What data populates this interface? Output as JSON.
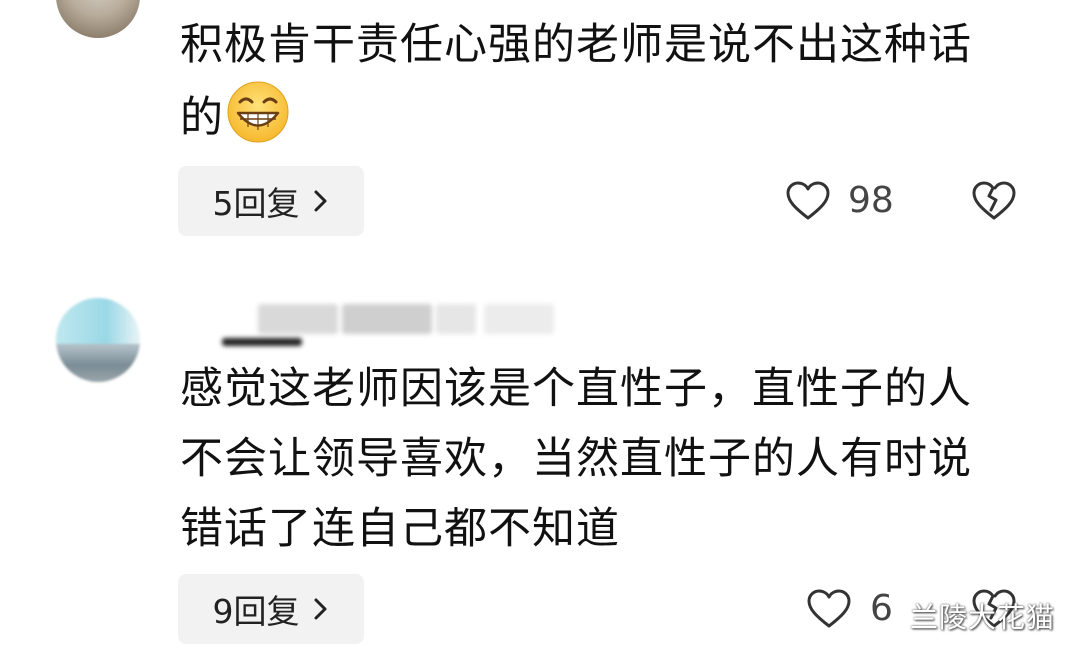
{
  "comments": [
    {
      "text": "积极肯干责任心强的老师是说不出这种话的",
      "emoji": "grinning-face-emoji",
      "replies_label": "5回复",
      "likes": "98"
    },
    {
      "text": "感觉这老师因该是个直性子，直性子的人不会让领导喜欢，当然直性子的人有时说错话了连自己都不知道",
      "replies_label": "9回复",
      "likes": "6"
    }
  ],
  "watermark": "兰陵大花猫",
  "colors": {
    "reply_bg": "#f2f2f2",
    "icon": "#333333",
    "text": "#111111"
  }
}
